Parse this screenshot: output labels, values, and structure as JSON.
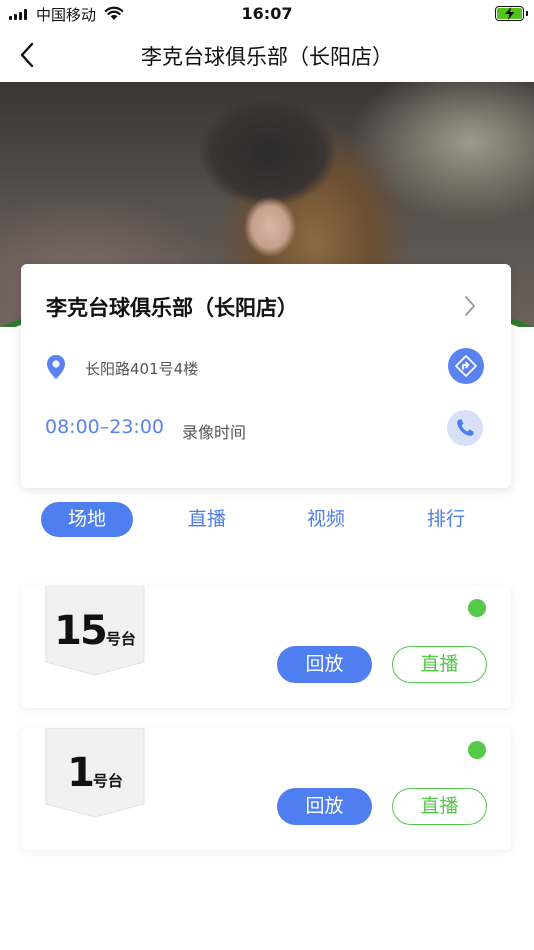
{
  "status_bar": {
    "carrier": "中国移动",
    "time": "16:07"
  },
  "nav": {
    "title": "李克台球俱乐部（长阳店）"
  },
  "club": {
    "name": "李克台球俱乐部（长阳店）",
    "address": "长阳路401号4楼",
    "hours": "08:00–23:00",
    "hours_label": "录像时间"
  },
  "tabs": [
    {
      "label": "场地",
      "active": true
    },
    {
      "label": "直播",
      "active": false
    },
    {
      "label": "视频",
      "active": false
    },
    {
      "label": "排行",
      "active": false
    }
  ],
  "tables": [
    {
      "number": "15",
      "unit": "号台",
      "status_color": "#55c94a",
      "replay_label": "回放",
      "live_label": "直播"
    },
    {
      "number": "1",
      "unit": "号台",
      "status_color": "#55c94a",
      "replay_label": "回放",
      "live_label": "直播"
    }
  ],
  "colors": {
    "accent_blue": "#4f7ef0",
    "accent_green": "#55c94a",
    "battery_green": "#52c41a"
  },
  "icons": {
    "back": "chevron-left-icon",
    "detail": "chevron-right-icon",
    "location": "location-pin-icon",
    "navigate": "navigation-icon",
    "phone": "phone-icon"
  }
}
